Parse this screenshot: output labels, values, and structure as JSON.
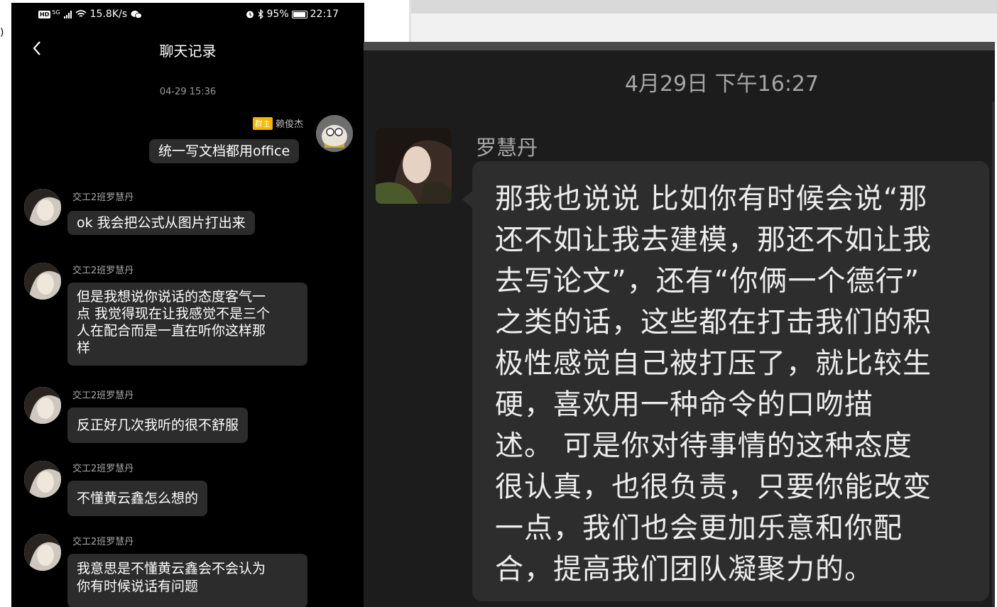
{
  "edge_fragment": ")",
  "statusbar": {
    "hd_label": "HD",
    "network_label": "5G",
    "speed": "15.8K/s",
    "battery_percent": "95%",
    "time": "22:17"
  },
  "navbar": {
    "title": "聊天记录"
  },
  "timestamp": "04-29 15:36",
  "my_message": {
    "badge": "群主",
    "sender": "赖俊杰",
    "text": "统一写文档都用office"
  },
  "messages": [
    {
      "sender": "交工2班罗慧丹",
      "text": "ok 我会把公式从图片打出来"
    },
    {
      "sender": "交工2班罗慧丹",
      "text": "但是我想说你说话的态度客气一\n点 我觉得现在让我感觉不是三个\n人在配合而是一直在听你这样那\n样"
    },
    {
      "sender": "交工2班罗慧丹",
      "text": "反正好几次我听的很不舒服"
    },
    {
      "sender": "交工2班罗慧丹",
      "text": "不懂黄云鑫怎么想的"
    },
    {
      "sender": "交工2班罗慧丹",
      "text": "我意思是不懂黄云鑫会不会认为\n你有时候说话有问题"
    }
  ],
  "zoom_view": {
    "time": "4月29日 下午16:27",
    "sender": "罗慧丹",
    "text": "那我也说说 比如你有时候会说“那\n还不如让我去建模，那还不如让我\n去写论文”，还有“你俩一个德行”\n之类的话，这些都在打击我们的积\n极性感觉自己被打压了，就比较生\n硬，喜欢用一种命令的口吻描\n述。 可是你对待事情的这种态度\n很认真，也很负责，只要你能改变\n一点，我们也会更加乐意和你配\n合，提高我们团队凝聚力的。"
  },
  "colors": {
    "phone_bg": "#000000",
    "bubble_bg": "#2c2c2c",
    "owner_badge": "#f5b400",
    "zoom_bg": "#1c1c1c"
  },
  "icons": [
    "back-chevron-icon",
    "signal-icon",
    "wifi-icon",
    "wechat-icon",
    "alarm-icon",
    "bluetooth-icon",
    "battery-icon"
  ]
}
